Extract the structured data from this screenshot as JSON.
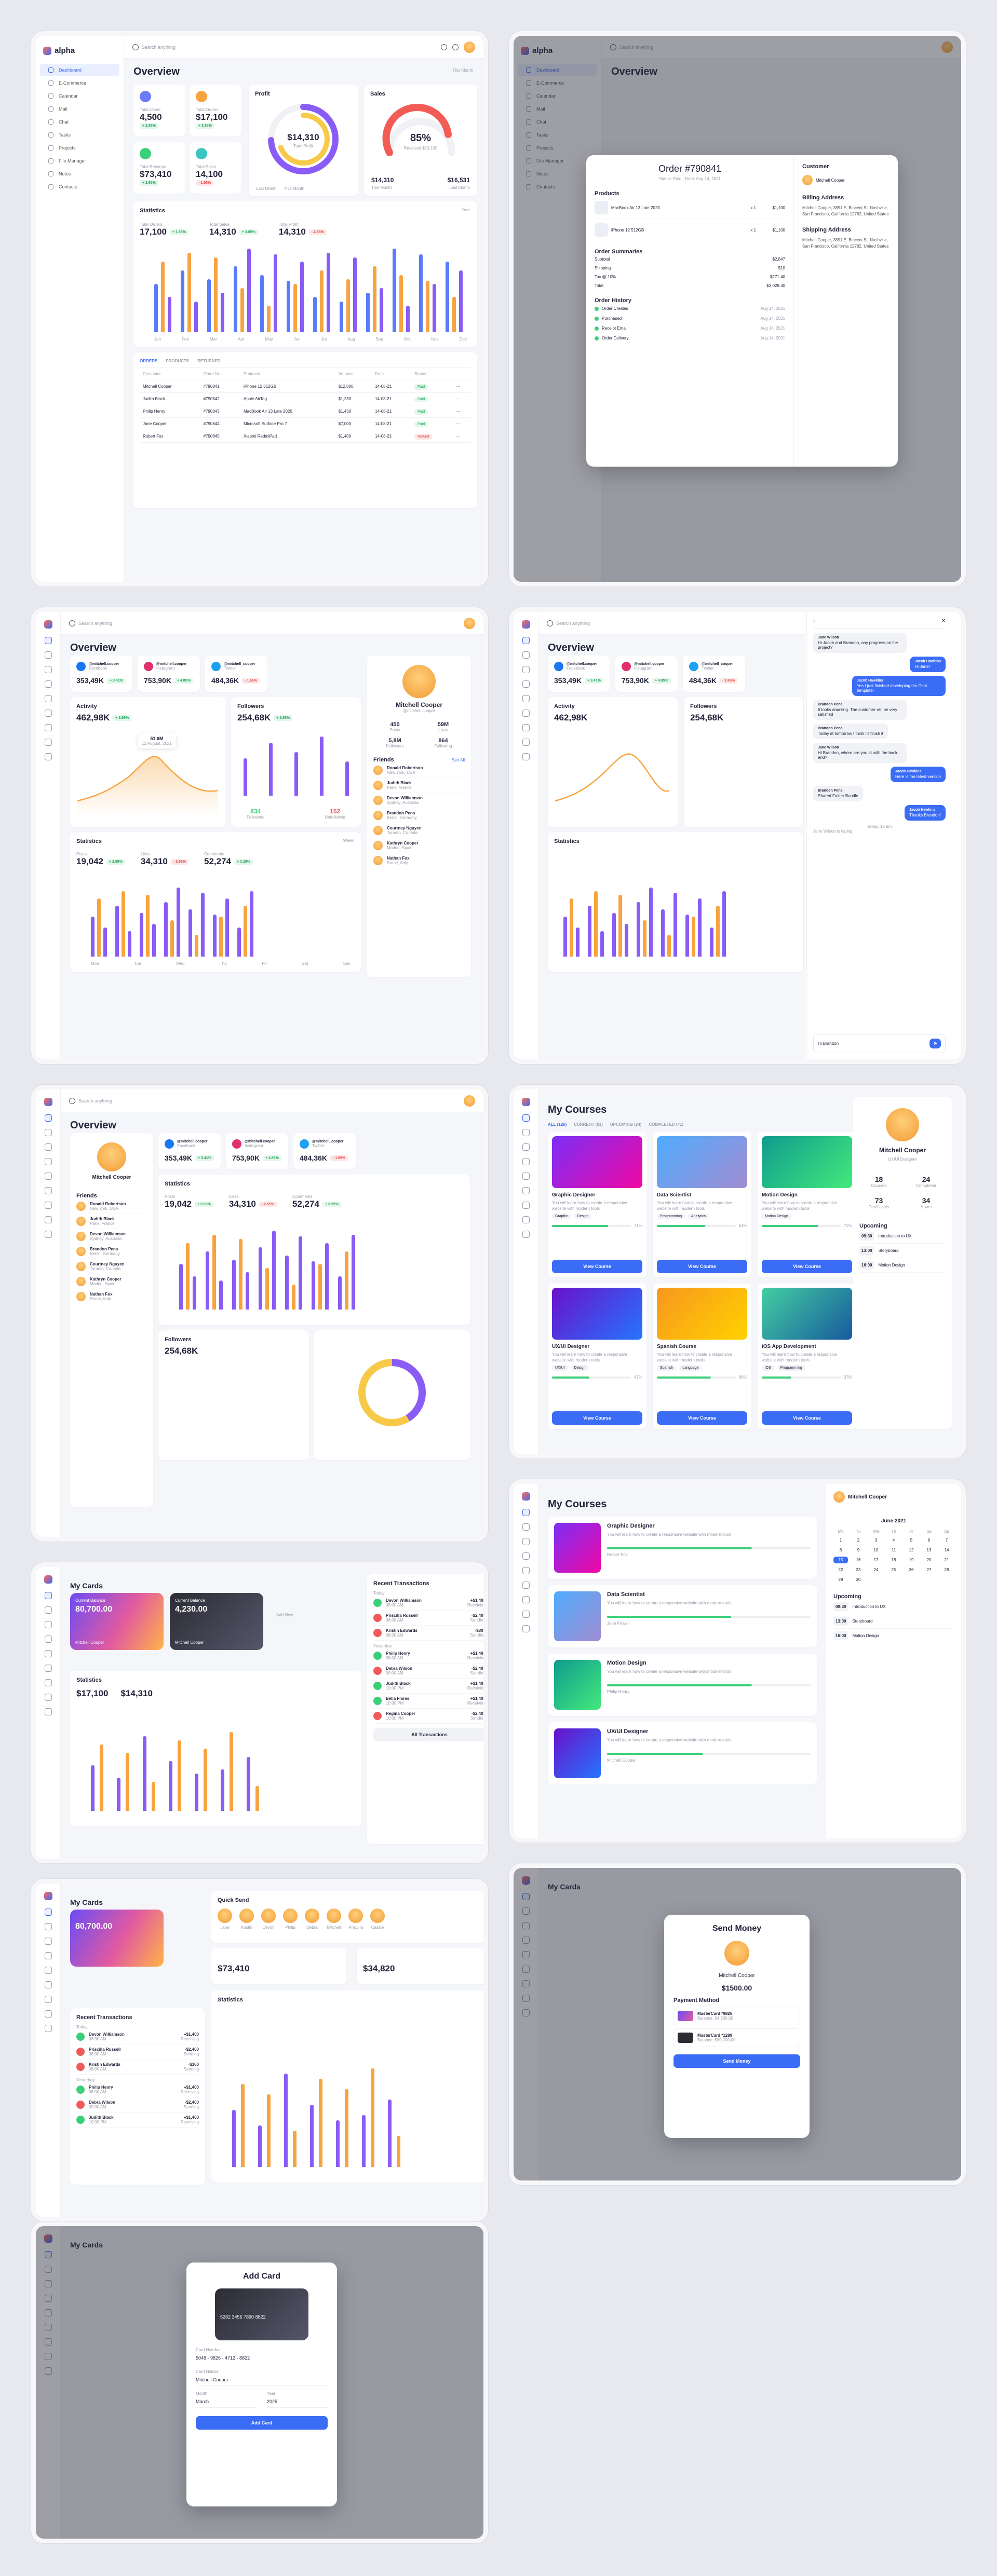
{
  "brand": "alpha",
  "search_placeholder": "Search anything",
  "sidebar": [
    "Dashboard",
    "E-Commerce",
    "Calendar",
    "Mail",
    "Chat",
    "Tasks",
    "Projects",
    "File Manager",
    "Notes",
    "Contacts"
  ],
  "s1": {
    "title": "Overview",
    "period": "This Month",
    "kpis": [
      {
        "label": "Total Users",
        "value": "4,500",
        "delta": "+ 2.65%",
        "trend": "up"
      },
      {
        "label": "Total Orders",
        "value": "$17,100",
        "delta": "+ 3.65%",
        "trend": "up"
      },
      {
        "label": "Total Revenue",
        "value": "$73,410",
        "delta": "+ 2.65%",
        "trend": "up"
      },
      {
        "label": "Total Sales",
        "value": "14,100",
        "delta": "- 1.65%",
        "trend": "down"
      }
    ],
    "profit": {
      "title": "Profit",
      "value": "$14,310",
      "sub": "Total Profit",
      "legend": [
        "Last Month",
        "This Month"
      ]
    },
    "sales": {
      "title": "Sales",
      "pct": "85%",
      "sub": "Received $13,100",
      "left_value": "$14,310",
      "left_label": "This Month",
      "right_value": "$16,531",
      "right_label": "Last Month"
    },
    "stats": {
      "title": "Statistics",
      "period": "Year",
      "items": [
        {
          "label": "Total Orders",
          "value": "17,100",
          "delta": "+ 1.65%"
        },
        {
          "label": "Total Sales",
          "value": "14,310",
          "delta": "+ 3.65%"
        },
        {
          "label": "Total Profit",
          "value": "14,310",
          "delta": "- 2.65%"
        }
      ],
      "months": [
        "Jan",
        "Feb",
        "Mar",
        "Apr",
        "May",
        "Jun",
        "Jul",
        "Aug",
        "Sep",
        "Oct",
        "Nov",
        "Dec"
      ]
    },
    "tabs": [
      "ORDERS",
      "PRODUCTS",
      "RETURNED"
    ],
    "table_headers": [
      "Customer",
      "Order No",
      "Products",
      "Amount",
      "Date",
      "Status"
    ],
    "orders": [
      [
        "Mitchell Cooper",
        "#790841",
        "iPhone 12 512GB",
        "$12,000",
        "14-08-21",
        "Paid"
      ],
      [
        "Judith Black",
        "#790842",
        "Apple AirTag",
        "$1,230",
        "14-08-21",
        "Paid"
      ],
      [
        "Philip Henry",
        "#790843",
        "MacBook Air 13 Late 2020",
        "$1,430",
        "14-08-21",
        "Paid"
      ],
      [
        "Jane Cooper",
        "#790844",
        "Microsoft Surface Pro 7",
        "$7,000",
        "14-08-21",
        "Paid"
      ],
      [
        "Robert Fox",
        "#790845",
        "Xiaomi RedmiPad",
        "$1,400",
        "14-08-21",
        "Refund"
      ]
    ]
  },
  "order_modal": {
    "title": "Order #790841",
    "status": "Status: Paid · Date: Aug 14, 2021",
    "products_label": "Products",
    "products": [
      {
        "name": "MacBook Air 13 Late 2020",
        "qty": "x 1",
        "price": "$1,100"
      },
      {
        "name": "iPhone 12 512GB",
        "qty": "x 1",
        "price": "$1,100"
      }
    ],
    "summary_label": "Order Summaries",
    "summary": [
      [
        "Subtotal",
        "$2,847"
      ],
      [
        "Shipping",
        "$10"
      ],
      [
        "Tax @ 10%",
        "$271.40"
      ],
      [
        "Total",
        "$3,028.40"
      ]
    ],
    "history_label": "Order History",
    "history": [
      [
        "Order Created",
        "Aug 14, 2021"
      ],
      [
        "Purchased",
        "Aug 14, 2021"
      ],
      [
        "Receipt Email",
        "Aug 14, 2021"
      ],
      [
        "Order Delivery",
        "Aug 14, 2021"
      ]
    ],
    "customer_label": "Customer",
    "customer": "Mitchell Cooper",
    "billing_label": "Billing Address",
    "billing": "Mitchell Cooper, 3891 E. Bincent St. Nashville, San Francisco, California 12782, United States",
    "shipping_label": "Shipping Address",
    "shipping": "Mitchell Cooper, 3891 E. Bincent St. Nashville, San Francisco, California 12782, United States"
  },
  "s3": {
    "socials": [
      {
        "handle": "@mitchell.cooper",
        "net": "Facebook",
        "value": "353,49K",
        "delta": "+ 3.41%",
        "color": "#1877f2"
      },
      {
        "handle": "@mitchell.cooper",
        "net": "Instagram",
        "value": "753,90K",
        "delta": "+ 4.85%",
        "color": "#e1306c"
      },
      {
        "handle": "@mitchell_cooper",
        "net": "Twitter",
        "value": "484,36K",
        "delta": "- 1.65%",
        "color": "#1da1f2"
      }
    ],
    "activity": {
      "title": "Activity",
      "value": "462,98K",
      "delta": "+ 2.65%",
      "tip": "51.6M",
      "tip_date": "12 August, 2021"
    },
    "followers": {
      "title": "Followers",
      "value": "254,68K",
      "delta": "+ 2.65%",
      "a": "834",
      "a_label": "Followers",
      "b": "152",
      "b_label": "Unfollowed"
    },
    "stats": {
      "title": "Statistics",
      "period": "Week",
      "items": [
        {
          "label": "Posts",
          "value": "19,042",
          "delta": "+ 2.65%"
        },
        {
          "label": "Likes",
          "value": "34,310",
          "delta": "- 2.65%"
        },
        {
          "label": "Comments",
          "value": "52,274",
          "delta": "+ 3.25%"
        }
      ],
      "days": [
        "Mon",
        "Tue",
        "Wed",
        "Thu",
        "Fri",
        "Sat",
        "Sun"
      ],
      "tip_date": "12 Aug, 2021",
      "tip": [
        "3,560",
        "2,580",
        "1,450"
      ]
    },
    "profile": {
      "name": "Mitchell Cooper",
      "handle": "@mitchell.cooper",
      "stats": [
        [
          "450",
          "Posts"
        ],
        [
          "59M",
          "Likes"
        ],
        [
          "5,8M",
          "Followers"
        ],
        [
          "864",
          "Following"
        ]
      ]
    },
    "friends_title": "Friends",
    "see_all": "See All",
    "friends": [
      [
        "Ronald Robertson",
        "New York, USA"
      ],
      [
        "Judith Black",
        "Paris, France"
      ],
      [
        "Devon Williamson",
        "Sydney, Australia"
      ],
      [
        "Brandon Pena",
        "Berlin, Germany"
      ],
      [
        "Courtney Nguyen",
        "Toronto, Canada"
      ],
      [
        "Kathryn Cooper",
        "Madrid, Spain"
      ],
      [
        "Nathan Fox",
        "Rome, Italy"
      ]
    ]
  },
  "chat": {
    "messages": [
      [
        "Jane Wilson",
        "Hi Jacob and Brandon, any progress on the project?"
      ],
      [
        "Jacob Hawkins",
        "Hi Jane!"
      ],
      [
        "Jacob Hawkins",
        "Yes I just finished developing the Chat template!"
      ],
      [
        "Brandon Pena",
        "It looks amazing. The customer will be very satisfied"
      ],
      [
        "Brandon Pena",
        "Today at tomorrow I think I'll finish it"
      ],
      [
        "Jane Wilson",
        "Hi Brandon, where are you at with the back-end?"
      ],
      [
        "Jacob Hawkins",
        "Here is the latest version"
      ],
      [
        "Brandon Pena",
        "Shared Folder Bundle"
      ],
      [
        "Jacob Hawkins",
        "Thanks Brandon!"
      ]
    ],
    "day": "Today, 12 am",
    "typing": "Jane Wilson is typing",
    "input": "Hi Brandon"
  },
  "courses": {
    "title": "My Courses",
    "tabs": [
      "ALL (126)",
      "CURRENT (61)",
      "UPCOMING (24)",
      "COMPLETED (41)"
    ],
    "items": [
      {
        "name": "Graphic Designer",
        "tags": [
          "Graphic",
          "Design"
        ],
        "author": "Robert Fox",
        "pct": "71%"
      },
      {
        "name": "Data Scientist",
        "tags": [
          "Programming",
          "Analytics"
        ],
        "author": "Jane Powell",
        "pct": "61%"
      },
      {
        "name": "Motion Design",
        "tags": [
          "Motion Design"
        ],
        "author": "Philip Henry",
        "pct": "71%"
      },
      {
        "name": "UX/UI Designer",
        "tags": [
          "UX/UI",
          "Design"
        ],
        "author": "Mitchell Cooper",
        "pct": "47%"
      },
      {
        "name": "Spanish Course",
        "tags": [
          "Spanish",
          "Language"
        ],
        "author": "Judith Black",
        "pct": "68%"
      },
      {
        "name": "iOS App Development",
        "tags": [
          "iOS",
          "Programming"
        ],
        "author": "Nathan Fox",
        "pct": "37%"
      }
    ],
    "desc": "You will learn how to create a responsive website with modern tools",
    "view": "View Course",
    "profile": {
      "name": "Mitchell Cooper",
      "role": "UX/UI Designer",
      "stats": [
        [
          "18",
          "Courses"
        ],
        [
          "24",
          "Completed"
        ],
        [
          "73",
          "Certificates"
        ],
        [
          "34",
          "Hours"
        ]
      ]
    },
    "upcoming_title": "Upcoming",
    "upcoming": [
      [
        "09:30",
        "Introduction to UX"
      ],
      [
        "13:00",
        "Storyboard"
      ],
      [
        "16:00",
        "Motion Design"
      ]
    ],
    "month": "June 2021",
    "weekdays": [
      "Mo",
      "Tu",
      "We",
      "Th",
      "Fr",
      "Sa",
      "Su"
    ]
  },
  "cards": {
    "title": "My Cards",
    "card1": {
      "label": "Current Balance",
      "value": "80,700.00",
      "number": "5282 3456 7890 1289",
      "holder": "Mitchell Cooper",
      "exp": "09/25"
    },
    "card2": {
      "label": "Current Balance",
      "value": "4,230.00",
      "number": "3466 0000 2345 1289",
      "holder": "Mitchell Cooper",
      "exp": "09/25"
    },
    "add": "Add New",
    "stats": {
      "title": "Statistics",
      "period": "Week",
      "income_label": "Income",
      "income": "$17,100",
      "income_delta": "+ 2.65%",
      "expense_label": "Expense",
      "expense": "$14,310",
      "expense_delta": "- 1.25%",
      "days": [
        "Mon",
        "Tue",
        "Wed",
        "Thu",
        "Fri",
        "Sat",
        "Sun"
      ]
    },
    "recent": "Recent Transactions",
    "today": "Today",
    "yesterday": "Yesterday",
    "tx": [
      [
        "Devon Williamson",
        "08:00 AM",
        "+$1,400",
        "Receiving"
      ],
      [
        "Priscilla Russell",
        "08:00 AM",
        "-$2,400",
        "Sending"
      ],
      [
        "Kristin Edwards",
        "08:00 AM",
        "-$300",
        "Sending"
      ],
      [
        "Philip Henry",
        "08:00 AM",
        "+$1,400",
        "Receiving"
      ],
      [
        "Debra Wilson",
        "09:00 AM",
        "-$2,400",
        "Sending"
      ],
      [
        "Judith Black",
        "10:00 PM",
        "+$1,400",
        "Receiving"
      ],
      [
        "Bella Flores",
        "10:00 PM",
        "+$1,400",
        "Receiving"
      ],
      [
        "Regina Cooper",
        "10:00 PM",
        "-$2,400",
        "Sending"
      ]
    ],
    "all_tx": "All Transactions",
    "quick_send": "Quick Send",
    "people": [
      "Jane",
      "Kristin",
      "Devon",
      "Philip",
      "Debra",
      "Mitchell",
      "Priscilla",
      "Cassie"
    ],
    "income_spark": "$73,410",
    "expense_spark": "$34,820"
  },
  "send_modal": {
    "title": "Send Money",
    "name": "Mitchell Cooper",
    "amount": "$1500.00",
    "method": "Payment Method",
    "methods": [
      [
        "MasterCard *9826",
        "Balance: $4,230.00"
      ],
      [
        "MasterCard *1289",
        "Balance: $80,700.00"
      ]
    ],
    "button": "Send Money"
  },
  "add_modal": {
    "title": "Add Card",
    "number_label": "Card Number",
    "number": "5048 - 9826 - 4712 - 8822",
    "holder_label": "Card Holder",
    "holder": "Mitchell Cooper",
    "month_label": "Month",
    "month": "March",
    "year_label": "Year",
    "year": "2025",
    "button": "Add Card",
    "preview_num": "5282 3456 7890 8822",
    "exp": "09/25"
  }
}
